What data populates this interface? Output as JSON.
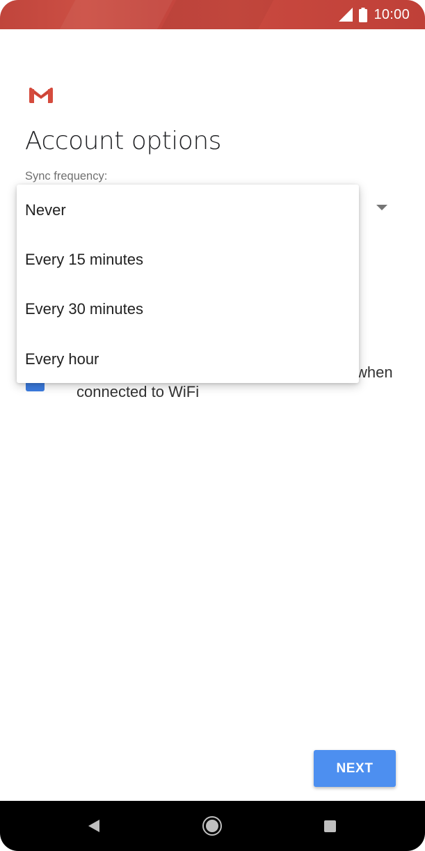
{
  "status_bar": {
    "time": "10:00",
    "icons": [
      "signal-icon",
      "battery-icon"
    ],
    "color": "#c4463e"
  },
  "app": {
    "logo": "gmail-logo"
  },
  "page": {
    "title": "Account options"
  },
  "sync": {
    "label": "Sync frequency:",
    "dropdown_open": true,
    "options": [
      "Never",
      "Every 15 minutes",
      "Every 30 minutes",
      "Every hour"
    ]
  },
  "background_content": {
    "wifi_option_partial": "when",
    "wifi_option_line2": "connected to WiFi",
    "checkbox_checked": true,
    "checkbox_color": "#3c7ce0"
  },
  "footer": {
    "next_label": "NEXT",
    "next_color": "#4d8ff0"
  },
  "nav_bar": {
    "icons": [
      "back-icon",
      "home-icon",
      "recents-icon"
    ]
  }
}
